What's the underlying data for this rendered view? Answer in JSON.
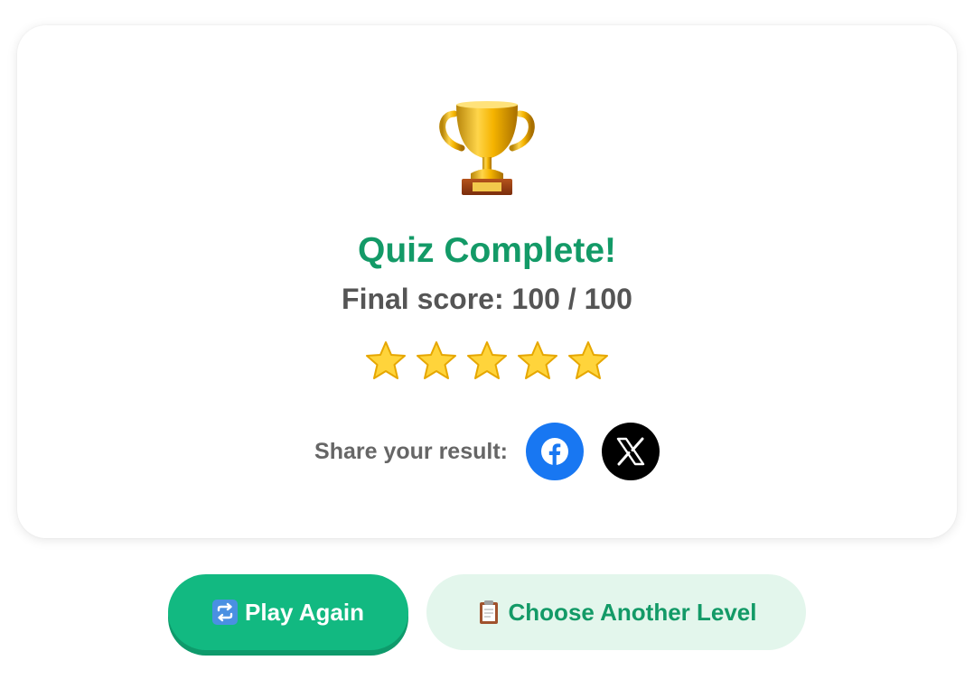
{
  "result": {
    "title": "Quiz Complete!",
    "score_label": "Final score: 100 / 100",
    "score": 100,
    "max_score": 100,
    "stars_earned": 5,
    "stars_total": 5
  },
  "share": {
    "label": "Share your result:",
    "networks": [
      "facebook-icon",
      "x-icon"
    ]
  },
  "actions": {
    "play_again_label": "Play Again",
    "choose_level_label": "Choose Another Level"
  },
  "colors": {
    "accent_green": "#12b981",
    "title_green": "#139a67",
    "light_green": "#e3f6ec",
    "facebook_blue": "#1877f2"
  }
}
